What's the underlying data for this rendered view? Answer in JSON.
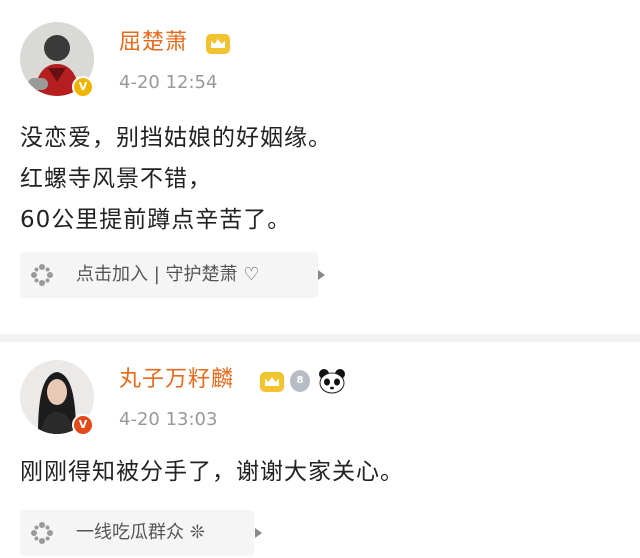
{
  "posts": [
    {
      "username": "屈楚萧",
      "timestamp": "4-20 12:54",
      "verified_badge": "V",
      "lines": [
        "没恋爱，别挡姑娘的好姻缘。",
        "红螺寺风景不错，",
        "60公里提前蹲点辛苦了。"
      ],
      "topic": "点击加入 | 守护楚萧 ♡"
    },
    {
      "username": "丸子万籽麟",
      "timestamp": "4-20 13:03",
      "verified_badge": "V",
      "medal_label": "8",
      "lines": [
        "刚刚得知被分手了，谢谢大家关心。"
      ],
      "topic": "一线吃瓜群众 ❊"
    }
  ],
  "colors": {
    "username": "#e86a1c",
    "timestamp": "#999999",
    "crown": "#f1c330",
    "badge_gold": "#f0b400",
    "badge_red": "#e24a1a",
    "chip_bg": "#f5f5f5"
  },
  "icons": {
    "crown": "crown-icon",
    "medal": "medal-icon",
    "panda": "panda-icon",
    "topic": "sparkle-icon",
    "arrow": "chevron-right-icon"
  }
}
